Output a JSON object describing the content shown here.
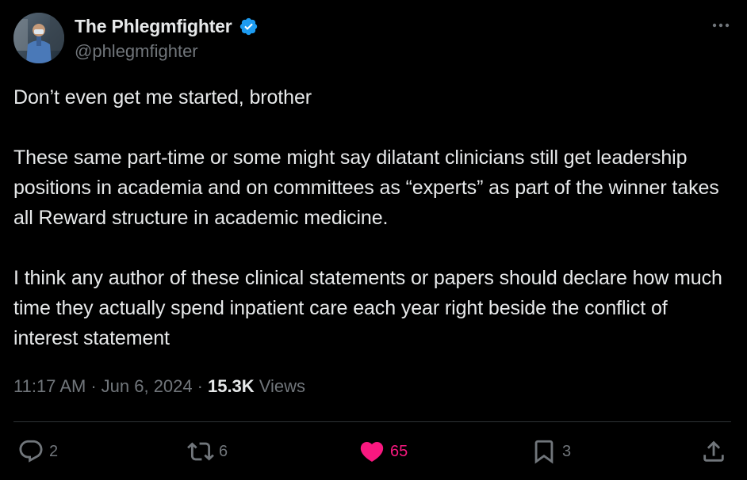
{
  "author": {
    "display_name": "The Phlegmfighter",
    "handle": "@phlegmfighter",
    "verified": true,
    "verified_color": "#1d9bf0"
  },
  "tweet": {
    "paragraphs": [
      "Don’t even get me started, brother",
      "These same part-time or some might say dilatant clinicians still get leadership positions in academia and on committees as “experts” as part of the winner takes all Reward structure in academic medicine.",
      "I think any author of these clinical statements or papers should declare how much time they actually spend inpatient care each year right beside the conflict of interest statement"
    ],
    "time": "11:17 AM",
    "separator": "·",
    "date": "Jun 6, 2024",
    "views_count": "15.3K",
    "views_label": "Views"
  },
  "actions": {
    "reply_count": "2",
    "repost_count": "6",
    "like_count": "65",
    "bookmark_count": "3",
    "like_color": "#f91880",
    "liked": true
  },
  "icons": {
    "avatar": "avatar-photo",
    "verified": "verified-badge-icon",
    "more": "more-options-icon",
    "reply": "reply-icon",
    "repost": "repost-icon",
    "like": "heart-filled-icon",
    "bookmark": "bookmark-icon",
    "share": "share-icon"
  },
  "colors": {
    "background": "#000000",
    "primary_text": "#e7e9ea",
    "secondary_text": "#71767b",
    "divider": "#2f3336"
  }
}
